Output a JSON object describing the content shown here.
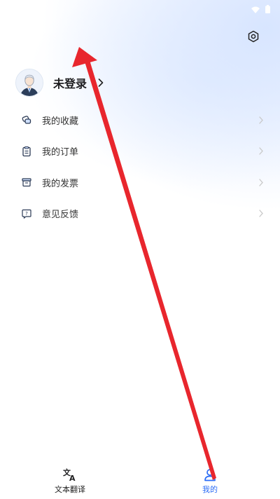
{
  "status_bar": {
    "icons": [
      "wifi-icon",
      "battery-icon"
    ]
  },
  "header": {
    "settings_icon": "settings-icon"
  },
  "profile": {
    "login_label": "未登录",
    "avatar_icon": "avatar"
  },
  "menu": {
    "items": [
      {
        "label": "我的收藏",
        "icon": "favorites-icon"
      },
      {
        "label": "我的订单",
        "icon": "orders-icon"
      },
      {
        "label": "我的发票",
        "icon": "invoice-icon"
      },
      {
        "label": "意见反馈",
        "icon": "feedback-icon"
      }
    ]
  },
  "tabbar": {
    "tabs": [
      {
        "label": "文本翻译",
        "icon": "translate-icon",
        "active": false
      },
      {
        "label": "我的",
        "icon": "profile-icon",
        "active": true
      }
    ]
  },
  "colors": {
    "accent": "#2b6cf6",
    "annotation_arrow": "#e8262d"
  }
}
